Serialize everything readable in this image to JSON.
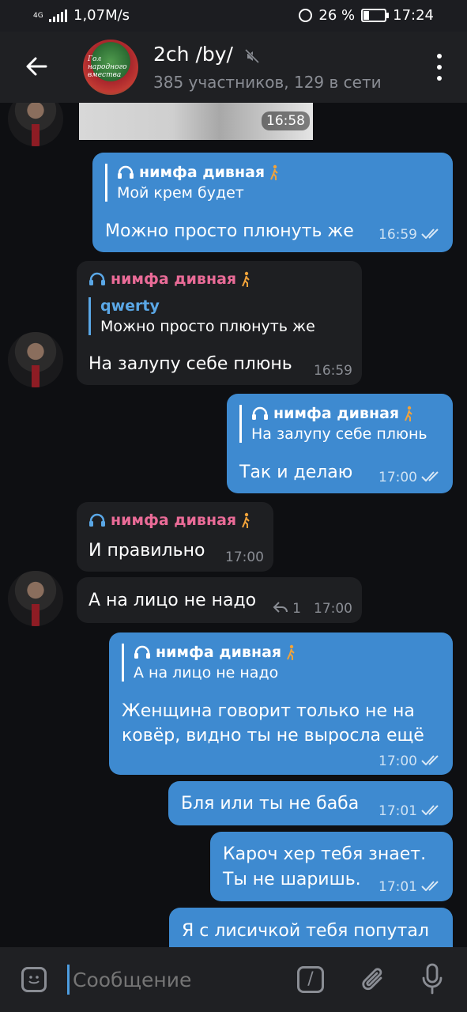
{
  "status_bar": {
    "network_type": "4G",
    "speed": "1,07M/s",
    "battery": "26 %",
    "time": "17:24"
  },
  "header": {
    "title": "2ch /by/",
    "subtitle": "385 участников, 129 в сети",
    "avatar_text": "Гол народного вмества",
    "accent_color": "#3e8ad0"
  },
  "messages": {
    "m0": {
      "time": "16:58"
    },
    "m1": {
      "reply_name": "нимфа дивная",
      "reply_text": "Мой крем будет",
      "text": "Можно просто плюнуть же",
      "time": "16:59"
    },
    "m2": {
      "sender": "нимфа дивная",
      "reply_name": "qwerty",
      "reply_text": "Можно просто плюнуть же",
      "text": "На залупу себе плюнь",
      "time": "16:59"
    },
    "m3": {
      "reply_name": "нимфа дивная",
      "reply_text": "На залупу себе плюнь",
      "text": "Так и делаю",
      "time": "17:00"
    },
    "m4": {
      "sender": "нимфа дивная",
      "text": "И правильно",
      "time": "17:00"
    },
    "m5": {
      "text": "А на лицо не надо",
      "replies": "1",
      "time": "17:00"
    },
    "m6": {
      "reply_name": "нимфа дивная",
      "reply_text": "А на лицо не надо",
      "text_line1": "Женщина говорит только не на",
      "text_line2": "ковёр, видно ты не выросла ещё",
      "time": "17:00"
    },
    "m7": {
      "text": "Бля или ты не баба",
      "time": "17:01"
    },
    "m8": {
      "text_line1": "Кароч хер тебя знает.",
      "text_line2": "Ты не шаришь.",
      "time": "17:01"
    },
    "m9": {
      "text": "Я с лисичкой тебя попутал"
    }
  },
  "input": {
    "placeholder": "Сообщение"
  }
}
